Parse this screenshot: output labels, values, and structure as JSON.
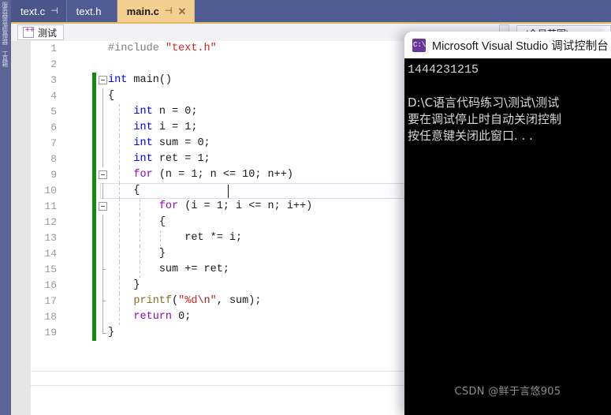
{
  "left_dock": {
    "label": "服务器资源管理器  工具箱"
  },
  "tabs": [
    {
      "label": "text.c",
      "pin": "⊣",
      "active": false,
      "closable": false
    },
    {
      "label": "text.h",
      "pin": "",
      "active": false,
      "closable": false
    },
    {
      "label": "main.c",
      "pin": "⊣",
      "active": true,
      "closable": true,
      "close": "✕"
    }
  ],
  "navbar": {
    "project_label": "测试",
    "icon": "cpp-project-icon",
    "scope_label": "(全局范围)",
    "minus": "_"
  },
  "editor": {
    "lines": [
      {
        "num": "1",
        "change": false,
        "fold": "none",
        "indent": 0,
        "tokens": [
          {
            "t": "#include ",
            "c": "pp"
          },
          {
            "t": "\"text.h\"",
            "c": "str"
          }
        ]
      },
      {
        "num": "2",
        "change": false,
        "fold": "none",
        "indent": 0,
        "tokens": []
      },
      {
        "num": "3",
        "change": true,
        "fold": "open",
        "indent": 0,
        "tokens": [
          {
            "t": "int",
            "c": "kw"
          },
          {
            "t": " main()",
            "c": "pl"
          }
        ]
      },
      {
        "num": "4",
        "change": true,
        "fold": "line",
        "indent": 0,
        "tokens": [
          {
            "t": "{",
            "c": "pl"
          }
        ]
      },
      {
        "num": "5",
        "change": true,
        "fold": "line",
        "indent": 1,
        "tokens": [
          {
            "t": "int",
            "c": "kw"
          },
          {
            "t": " n = ",
            "c": "pl"
          },
          {
            "t": "0",
            "c": "num"
          },
          {
            "t": ";",
            "c": "pl"
          }
        ]
      },
      {
        "num": "6",
        "change": true,
        "fold": "line",
        "indent": 1,
        "tokens": [
          {
            "t": "int",
            "c": "kw"
          },
          {
            "t": " i = ",
            "c": "pl"
          },
          {
            "t": "1",
            "c": "num"
          },
          {
            "t": ";",
            "c": "pl"
          }
        ]
      },
      {
        "num": "7",
        "change": true,
        "fold": "line",
        "indent": 1,
        "tokens": [
          {
            "t": "int",
            "c": "kw"
          },
          {
            "t": " sum = ",
            "c": "pl"
          },
          {
            "t": "0",
            "c": "num"
          },
          {
            "t": ";",
            "c": "pl"
          }
        ]
      },
      {
        "num": "8",
        "change": true,
        "fold": "line",
        "indent": 1,
        "current": true,
        "tokens": [
          {
            "t": "int",
            "c": "kw"
          },
          {
            "t": " ret = ",
            "c": "pl"
          },
          {
            "t": "1",
            "c": "num"
          },
          {
            "t": ";",
            "c": "pl"
          }
        ]
      },
      {
        "num": "9",
        "change": true,
        "fold": "open2",
        "indent": 1,
        "tokens": [
          {
            "t": "for",
            "c": "ctl"
          },
          {
            "t": " (n = ",
            "c": "pl"
          },
          {
            "t": "1",
            "c": "num"
          },
          {
            "t": "; n <= ",
            "c": "pl"
          },
          {
            "t": "10",
            "c": "num"
          },
          {
            "t": "; n++)",
            "c": "pl"
          }
        ]
      },
      {
        "num": "10",
        "change": true,
        "fold": "line",
        "indent": 1,
        "tokens": [
          {
            "t": "{",
            "c": "pl"
          }
        ]
      },
      {
        "num": "11",
        "change": true,
        "fold": "open3",
        "indent": 2,
        "tokens": [
          {
            "t": "for",
            "c": "ctl"
          },
          {
            "t": " (i = ",
            "c": "pl"
          },
          {
            "t": "1",
            "c": "num"
          },
          {
            "t": "; i <= n; i++)",
            "c": "pl"
          }
        ]
      },
      {
        "num": "12",
        "change": true,
        "fold": "line",
        "indent": 2,
        "tokens": [
          {
            "t": "{",
            "c": "pl"
          }
        ]
      },
      {
        "num": "13",
        "change": true,
        "fold": "line",
        "indent": 3,
        "tokens": [
          {
            "t": "ret *= i;",
            "c": "pl"
          }
        ]
      },
      {
        "num": "14",
        "change": true,
        "fold": "line",
        "indent": 2,
        "tokens": [
          {
            "t": "}",
            "c": "pl"
          }
        ]
      },
      {
        "num": "15",
        "change": true,
        "fold": "tick",
        "indent": 2,
        "tokens": [
          {
            "t": "sum += ret;",
            "c": "pl"
          }
        ]
      },
      {
        "num": "16",
        "change": true,
        "fold": "line",
        "indent": 1,
        "tokens": [
          {
            "t": "}",
            "c": "pl"
          }
        ]
      },
      {
        "num": "17",
        "change": true,
        "fold": "tick",
        "indent": 1,
        "tokens": [
          {
            "t": "printf",
            "c": "fn"
          },
          {
            "t": "(",
            "c": "pl"
          },
          {
            "t": "\"%d",
            "c": "str"
          },
          {
            "t": "\\n",
            "c": "esc"
          },
          {
            "t": "\"",
            "c": "str"
          },
          {
            "t": ", sum);",
            "c": "pl"
          }
        ]
      },
      {
        "num": "18",
        "change": true,
        "fold": "line",
        "indent": 1,
        "tokens": [
          {
            "t": "return",
            "c": "ctl"
          },
          {
            "t": " ",
            "c": "pl"
          },
          {
            "t": "0",
            "c": "num"
          },
          {
            "t": ";",
            "c": "pl"
          }
        ]
      },
      {
        "num": "19",
        "change": true,
        "fold": "end",
        "indent": 0,
        "tokens": [
          {
            "t": "}",
            "c": "pl"
          }
        ]
      }
    ]
  },
  "console": {
    "title": "Microsoft Visual Studio 调试控制台",
    "icon": "console-cmd-icon",
    "output": [
      "1444231215",
      "",
      "D:\\C语言代码练习\\测试\\测试",
      "要在调试停止时自动关闭控制",
      "按任意键关闭此窗口. . ."
    ]
  },
  "watermark": "CSDN @鲜于言悠905"
}
